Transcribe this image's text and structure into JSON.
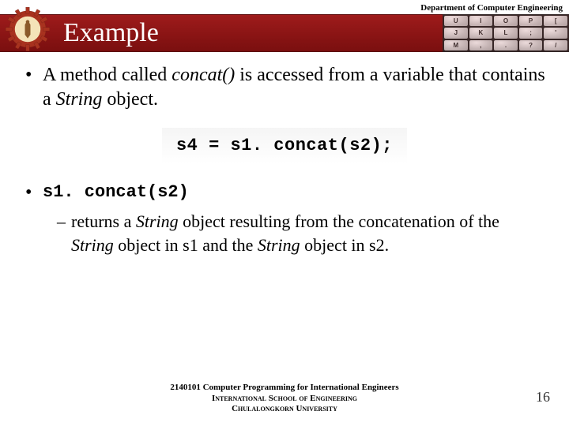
{
  "header": {
    "department": "Department of Computer Engineering",
    "title": "Example"
  },
  "keyboard": {
    "keys": [
      "U",
      "I",
      "O",
      "P",
      "[",
      "J",
      "K",
      "L",
      ";",
      "'",
      "M",
      ",",
      ".",
      "?",
      "/"
    ]
  },
  "body": {
    "bullet1_pre": "A method called ",
    "bullet1_method": "concat()",
    "bullet1_mid": "  is accessed from a variable that contains a ",
    "bullet1_obj": "String",
    "bullet1_post": " object.",
    "code_example": "s4 = s1. concat(s2);",
    "bullet2_code": "s1. concat(s2)",
    "sub_pre": "returns a ",
    "sub_obj1": "String",
    "sub_mid1": " object resulting from the concatenation of the ",
    "sub_obj2": "String",
    "sub_mid2": " object in s1 and the ",
    "sub_obj3": "String",
    "sub_post": " object in s2."
  },
  "footer": {
    "line1": "2140101 Computer Programming for International Engineers",
    "line2": "International School of Engineering",
    "line3": "Chulalongkorn University",
    "page": "16"
  }
}
